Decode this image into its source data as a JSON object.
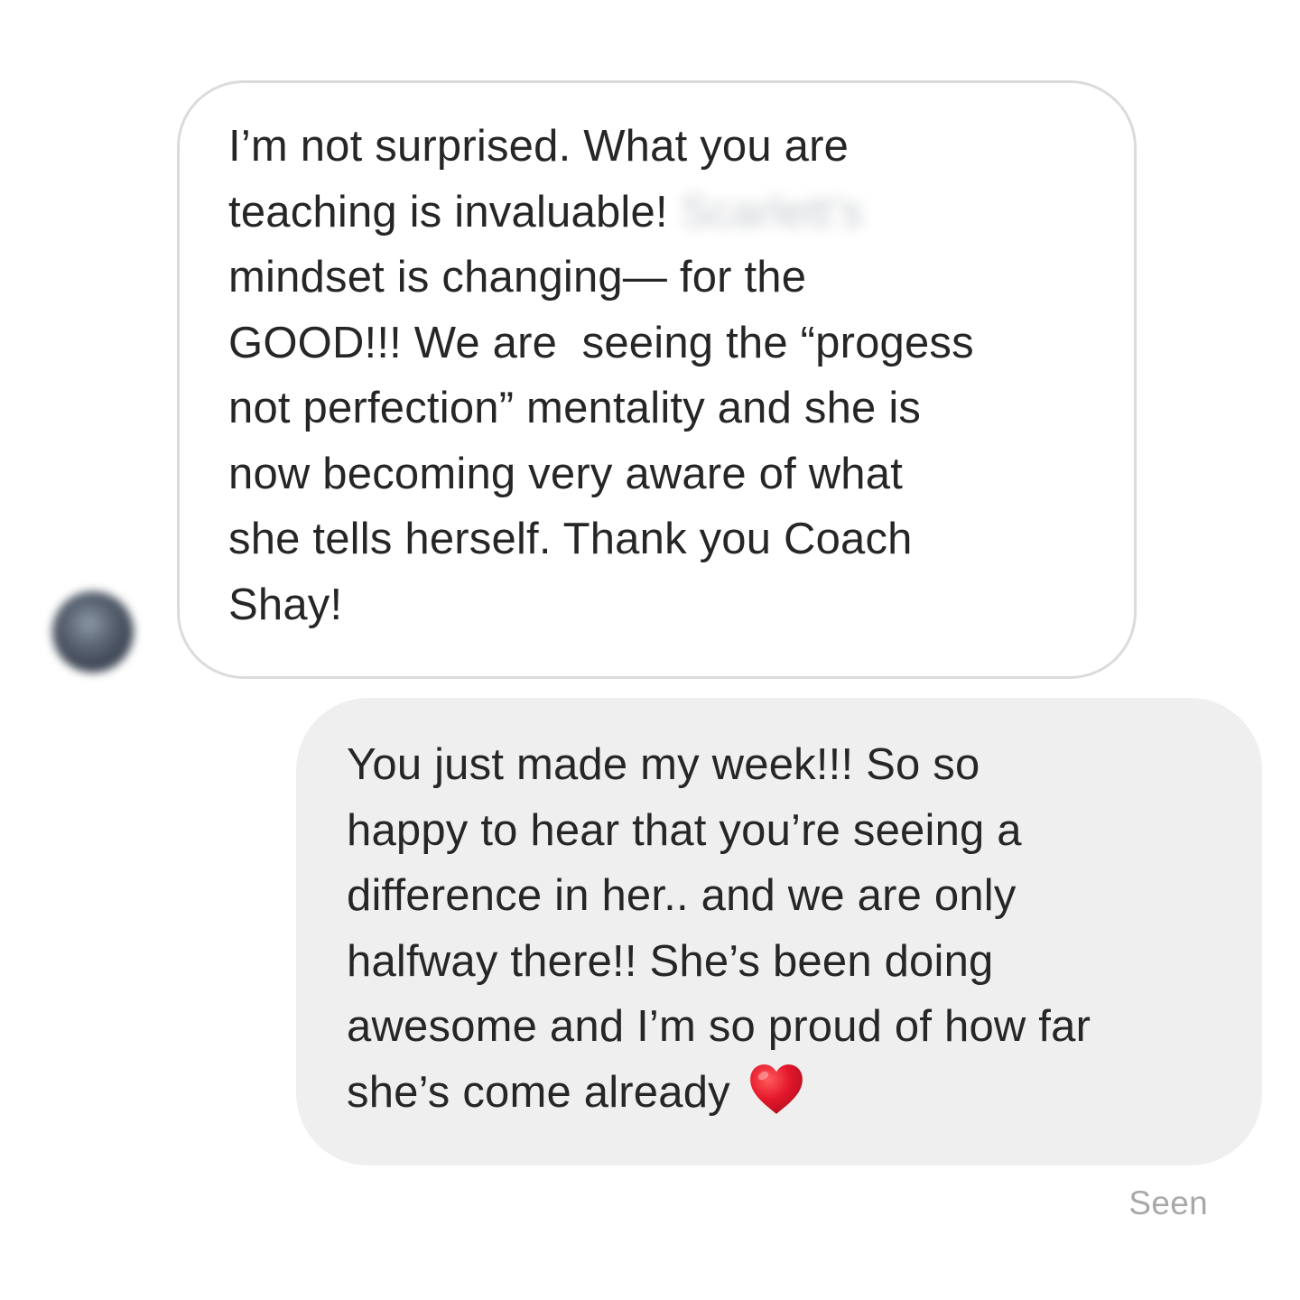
{
  "incoming_message": {
    "lines": [
      "I’m not surprised. What you are",
      "teaching is invaluable!",
      "mindset is changing— for the",
      "GOOD!!! We are  seeing the “progess",
      "not perfection” mentality and she is",
      "now becoming very aware of what",
      "she tells herself. Thank you Coach",
      "Shay!"
    ],
    "redacted_text": "Scarlett’s"
  },
  "outgoing_message": {
    "lines": [
      "You just made my week!!! So so",
      "happy to hear that you’re seeing a",
      "difference in her.. and we are only",
      "halfway there!! She’s been doing",
      "awesome and I’m so proud of how far",
      "she’s come already"
    ],
    "emoji": "red-heart-icon"
  },
  "status": {
    "seen_label": "Seen"
  },
  "colors": {
    "incoming_border": "#dbdbdb",
    "outgoing_background": "#efefef",
    "text": "#262626",
    "seen_text": "#a8a8a8",
    "heart": "#e3172b"
  }
}
